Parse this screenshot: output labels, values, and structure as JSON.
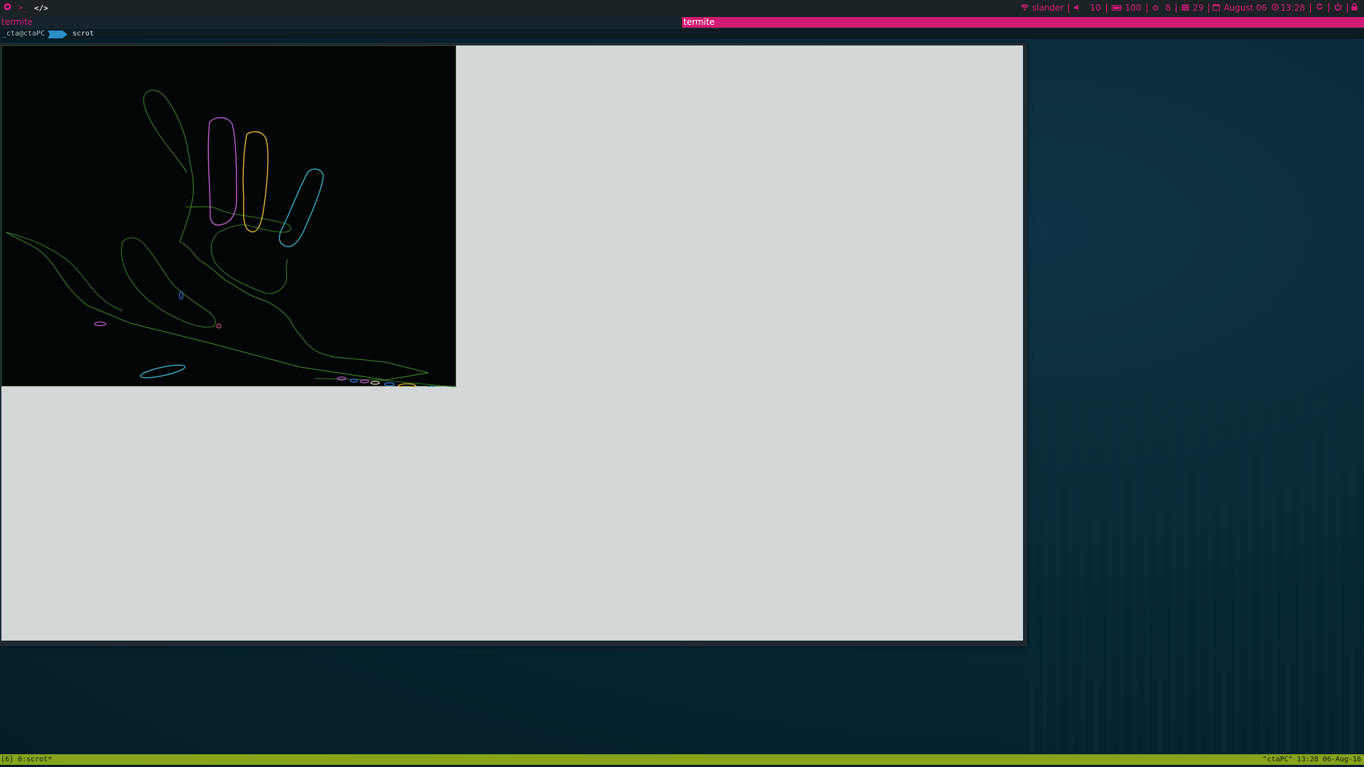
{
  "topbar": {
    "left_icons": [
      "app-logo-icon",
      "terminal-icon",
      "code-icon"
    ],
    "terminal_glyph": ">_",
    "code_glyph": "</>",
    "wifi": {
      "icon": "wifi-icon",
      "label": "slander"
    },
    "volume": {
      "icon": "volume-icon",
      "value": "10"
    },
    "battery": {
      "icon": "battery-icon",
      "value": "100"
    },
    "cpu": {
      "icon": "gear-icon",
      "value": "8"
    },
    "memory": {
      "icon": "memory-icon",
      "value": "29"
    },
    "date": {
      "icon": "calendar-icon",
      "value": "August 06"
    },
    "time": {
      "icon": "clock-icon",
      "value": "13:28"
    },
    "actions": [
      "refresh-icon",
      "power-icon",
      "lock-icon"
    ]
  },
  "windows": {
    "left_title": "termite",
    "right_title": "termite"
  },
  "terminal": {
    "prompt_user": "_cta@ctaPC",
    "command": "scrot"
  },
  "statusbar": {
    "left": "[6] 0:scrot*",
    "right": "\"ctaPC\" 13:28 06-Aug-16"
  },
  "colors": {
    "accent": "#d81b77",
    "status_bg": "#86a31a",
    "viewer_bg": "#d3d7d8",
    "image_bg": "#020506",
    "contour_green": "#3c7a26",
    "contour_magenta": "#c25fd0",
    "contour_yellow": "#e8b93a",
    "contour_cyan": "#3bb2c8",
    "contour_blue": "#3a7be0"
  }
}
